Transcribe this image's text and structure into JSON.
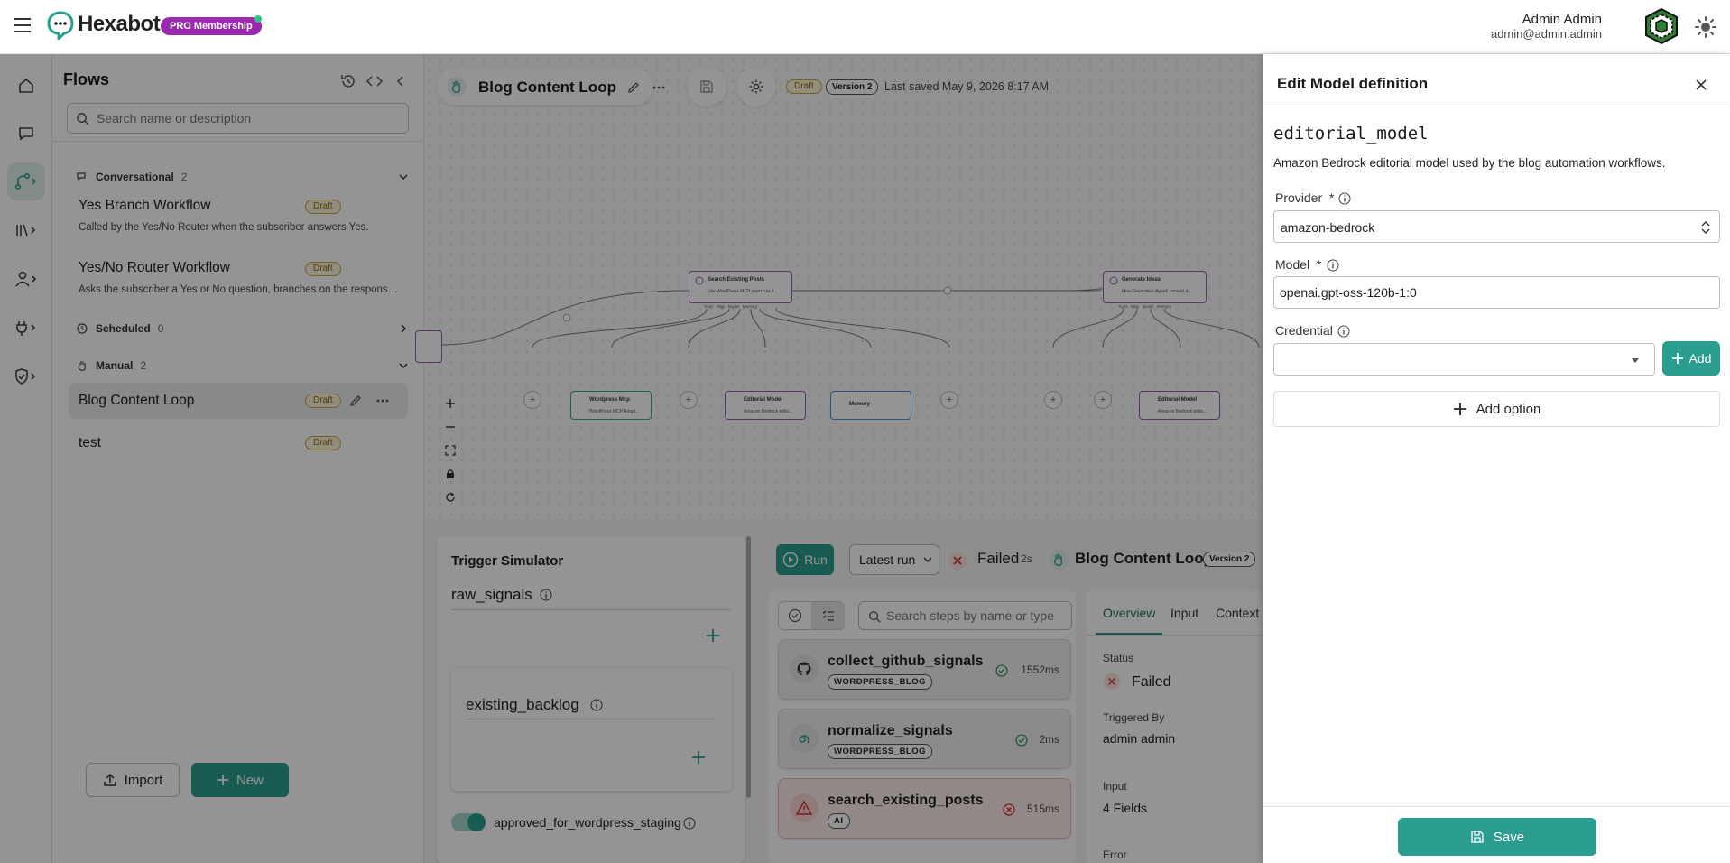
{
  "app": {
    "name": "Hexabot",
    "badge": "PRO Membership"
  },
  "user": {
    "name": "Admin Admin",
    "email": "admin@admin.admin"
  },
  "flows_panel": {
    "title": "Flows",
    "search_placeholder": "Search name or description",
    "categories": [
      {
        "label": "Conversational",
        "count": "2"
      },
      {
        "label": "Scheduled",
        "count": "0"
      },
      {
        "label": "Manual",
        "count": "2"
      }
    ],
    "items": [
      {
        "name": "Yes Branch Workflow",
        "status": "Draft",
        "description": "Called by the Yes/No Router when the subscriber answers Yes."
      },
      {
        "name": "Yes/No Router Workflow",
        "status": "Draft",
        "description": "Asks the subscriber a Yes or No question, branches on the response..."
      },
      {
        "name": "Blog Content Loop",
        "status": "Draft",
        "description": ""
      },
      {
        "name": "test",
        "status": "Draft",
        "description": ""
      }
    ],
    "import_label": "Import",
    "new_label": "New"
  },
  "canvas": {
    "flow_title": "Blog Content Loop",
    "status": "Draft",
    "version": "Version 2",
    "last_saved": "Last saved May 9, 2026 8:17 AM",
    "nodes": {
      "search_title": "Search Existing Posts",
      "search_sub": "Use WordPress MCP search to d...",
      "generate_title": "Generate Ideas",
      "generate_sub": "Idea Generation Agent: convert d...",
      "wordpress_title": "Wordpress Mcp",
      "wordpress_sub": "WordPress MCP Adapt...",
      "editorial_title": "Editorial Model",
      "editorial_sub": "Amazon Bedrock edito...",
      "memory_title": "Memory",
      "ports": [
        "Tools",
        "Map",
        "Model",
        "Memory"
      ]
    }
  },
  "simulator": {
    "title": "Trigger Simulator",
    "field1": "raw_signals",
    "field2": "existing_backlog",
    "toggle_label": "approved_for_wordpress_staging",
    "toggle_on": true
  },
  "run_panel": {
    "run_label": "Run",
    "run_select": "Latest run",
    "status": "Failed",
    "duration": "2s",
    "flow_name": "Blog Content Loop",
    "version": "Version 2",
    "search_placeholder": "Search steps by name or type",
    "steps": [
      {
        "name": "collect_github_signals",
        "tag": "WORDPRESS_BLOG",
        "time": "1552ms",
        "state": "ok"
      },
      {
        "name": "normalize_signals",
        "tag": "WORDPRESS_BLOG",
        "time": "2ms",
        "state": "ok"
      },
      {
        "name": "search_existing_posts",
        "tag": "AI",
        "time": "515ms",
        "state": "error"
      }
    ],
    "tabs": [
      "Overview",
      "Input",
      "Context"
    ],
    "overview": {
      "status_label": "Status",
      "status_value": "Failed",
      "triggered_label": "Triggered By",
      "triggered_value": "admin admin",
      "input_label": "Input",
      "input_value": "4 Fields",
      "error_label": "Error"
    }
  },
  "drawer": {
    "title": "Edit Model definition",
    "model_key": "editorial_model",
    "description": "Amazon Bedrock editorial model used by the blog automation workflows.",
    "provider_label": "Provider",
    "provider_value": "amazon-bedrock",
    "model_label": "Model",
    "model_value": "openai.gpt-oss-120b-1:0",
    "credential_label": "Credential",
    "credential_value": "",
    "required_mark": "*",
    "add_label": "Add",
    "add_option_label": "Add option",
    "save_label": "Save"
  },
  "colors": {
    "accent": "#2a9d8f",
    "pro_badge": "#9c27b0",
    "draft": "#c9a23a",
    "error": "#d32f2f",
    "node_border": "#9b59b6"
  }
}
